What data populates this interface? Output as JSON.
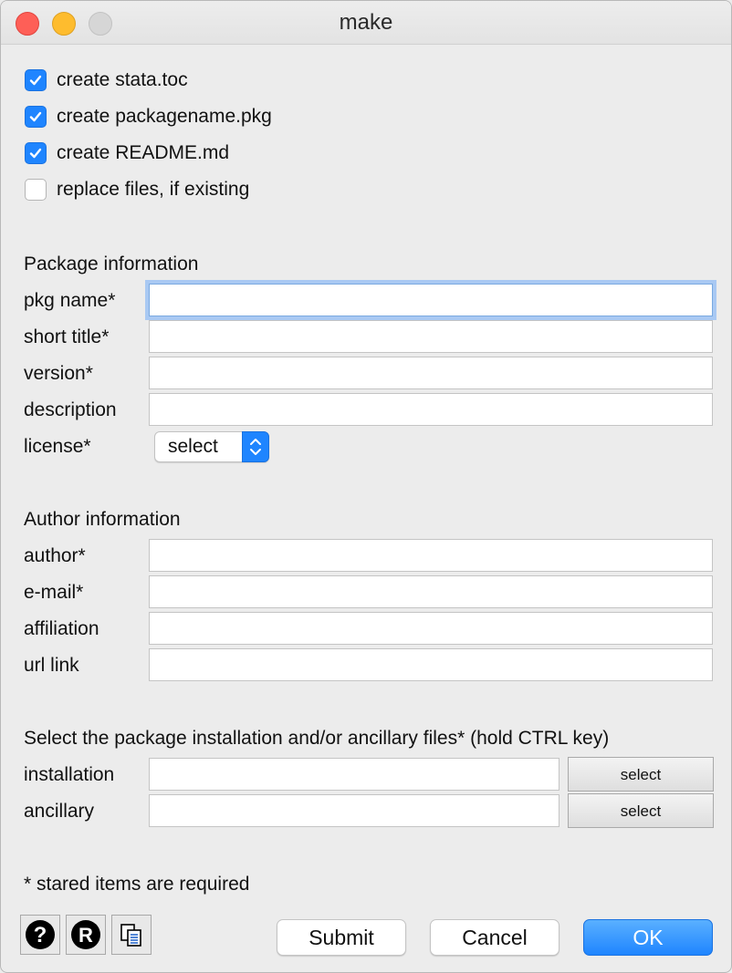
{
  "window": {
    "title": "make"
  },
  "options": [
    {
      "label": "create stata.toc",
      "checked": true
    },
    {
      "label": "create packagename.pkg",
      "checked": true
    },
    {
      "label": "create README.md",
      "checked": true
    },
    {
      "label": "replace files, if existing",
      "checked": false
    }
  ],
  "package": {
    "heading": "Package information",
    "pkg_name_label": "pkg name*",
    "pkg_name_value": "",
    "short_title_label": "short title*",
    "short_title_value": "",
    "version_label": "version*",
    "version_value": "",
    "description_label": "description",
    "description_value": "",
    "license_label": "license*",
    "license_value": "select"
  },
  "author": {
    "heading": "Author information",
    "author_label": "author*",
    "author_value": "",
    "email_label": "e-mail*",
    "email_value": "",
    "affiliation_label": "affiliation",
    "affiliation_value": "",
    "url_label": "url link",
    "url_value": ""
  },
  "files": {
    "heading": "Select the package installation and/or ancillary files*  (hold CTRL key)",
    "installation_label": "installation",
    "installation_value": "",
    "installation_button": "select",
    "ancillary_label": "ancillary",
    "ancillary_value": "",
    "ancillary_button": "select"
  },
  "note": "* stared items are required",
  "footer": {
    "help_icon": "help-icon",
    "r_icon": "r-icon",
    "copy_icon": "copy-icon",
    "submit": "Submit",
    "cancel": "Cancel",
    "ok": "OK"
  },
  "colors": {
    "accent": "#1f85ff",
    "focus_ring": "#a9c9f3",
    "background": "#ececec"
  }
}
